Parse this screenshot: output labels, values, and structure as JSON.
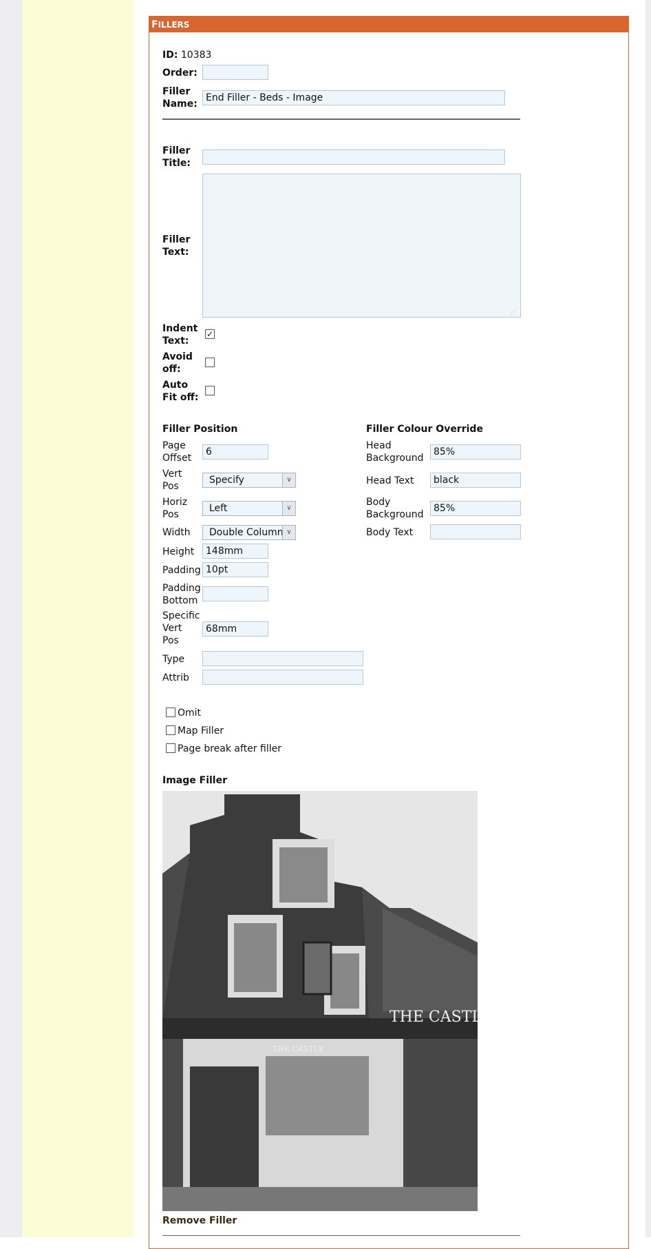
{
  "panel": {
    "title_first": "F",
    "title_rest": "ILLERS"
  },
  "fields": {
    "id_label": "ID:",
    "id_value": "10383",
    "order_label": "Order:",
    "order_value": "",
    "name_label_1": "Filler",
    "name_label_2": "Name:",
    "name_value": "End Filler - Beds - Image",
    "title_label_1": "Filler",
    "title_label_2": "Title:",
    "title_value": "",
    "text_label_1": "Filler",
    "text_label_2": "Text:",
    "text_value": "",
    "indent_label_1": "Indent",
    "indent_label_2": "Text:",
    "indent_checked": true,
    "avoid_label_1": "Avoid",
    "avoid_label_2": "off:",
    "avoid_checked": false,
    "autofit_label_1": "Auto",
    "autofit_label_2": "Fit off:",
    "autofit_checked": false
  },
  "position": {
    "heading": "Filler Position",
    "page_offset_label_1": "Page",
    "page_offset_label_2": "Offset",
    "page_offset_value": "6",
    "vert_pos_label_1": "Vert",
    "vert_pos_label_2": "Pos",
    "vert_pos_value": "Specify",
    "horiz_pos_label_1": "Horiz",
    "horiz_pos_label_2": "Pos",
    "horiz_pos_value": "Left",
    "width_label": "Width",
    "width_value": "Double Column",
    "height_label": "Height",
    "height_value": "148mm",
    "padding_label": "Padding",
    "padding_value": "10pt",
    "padding_bottom_label_1": "Padding",
    "padding_bottom_label_2": "Bottom",
    "padding_bottom_value": "",
    "specific_label_1": "Specific",
    "specific_label_2": "Vert",
    "specific_label_3": "Pos",
    "specific_value": "68mm",
    "type_label": "Type",
    "type_value": "",
    "attrib_label": "Attrib",
    "attrib_value": ""
  },
  "colour": {
    "heading": "Filler Colour Override",
    "head_bg_label_1": "Head",
    "head_bg_label_2": "Background",
    "head_bg_value": "85%",
    "head_text_label": "Head Text",
    "head_text_value": "black",
    "body_bg_label_1": "Body",
    "body_bg_label_2": "Background",
    "body_bg_value": "85%",
    "body_text_label": "Body Text",
    "body_text_value": ""
  },
  "options": {
    "omit_label": "Omit",
    "omit_checked": false,
    "map_label": "Map Filler",
    "map_checked": false,
    "pagebreak_label": "Page break after filler",
    "pagebreak_checked": false
  },
  "image": {
    "heading": "Image Filler",
    "sign_main": "THE CASTLE",
    "sign_fascia": "THE CASTLE",
    "remove_label": "Remove Filler"
  },
  "colors": {
    "accent": "#d9662f",
    "sidebar": "#fcfcd6",
    "input_bg": "#eef6fc"
  },
  "icons": {
    "checkbox_checked": "checkmark-icon",
    "select_arrow": "chevron-down-icon",
    "resize": "resize-grip-icon"
  }
}
